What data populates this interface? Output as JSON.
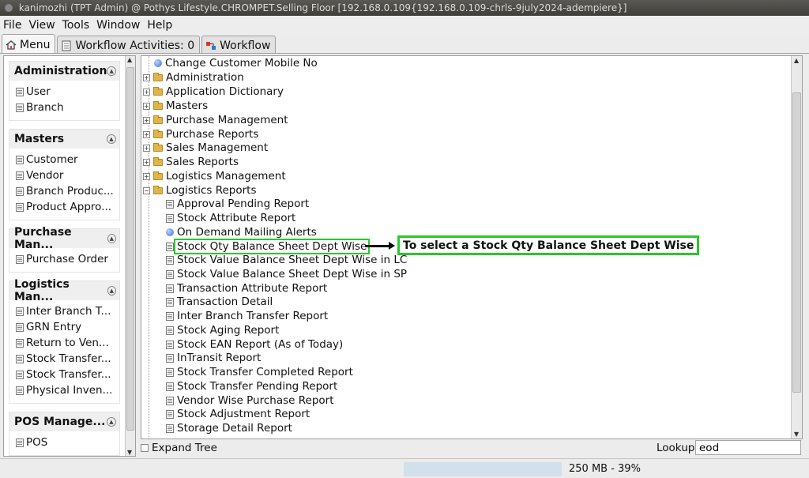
{
  "window": {
    "title": "kanimozhi (TPT Admin) @ Pothys Lifestyle.CHROMPET.Selling Floor [192.168.0.109{192.168.0.109-chrls-9july2024-adempiere}]"
  },
  "menubar": [
    {
      "label": "File"
    },
    {
      "label": "View"
    },
    {
      "label": "Tools"
    },
    {
      "label": "Window"
    },
    {
      "label": "Help"
    }
  ],
  "tabs": [
    {
      "label": "Menu",
      "icon": "home-icon",
      "active": true
    },
    {
      "label": "Workflow Activities: 0",
      "icon": "document-icon",
      "active": false
    },
    {
      "label": "Workflow",
      "icon": "workflow-icon",
      "active": false
    }
  ],
  "sidebar": {
    "groups": [
      {
        "title": "Administration",
        "items": [
          "User",
          "Branch"
        ]
      },
      {
        "title": "Masters",
        "items": [
          "Customer",
          "Vendor",
          "Branch Produc...",
          "Product Appro..."
        ]
      },
      {
        "title": "Purchase Man...",
        "items": [
          "Purchase Order"
        ]
      },
      {
        "title": "Logistics Man...",
        "items": [
          "Inter Branch T...",
          "GRN Entry",
          "Return to Ven...",
          "Stock Transfer...",
          "Stock Transfer...",
          "Physical Inven..."
        ]
      },
      {
        "title": "POS Manage...",
        "items": [
          "POS"
        ]
      }
    ]
  },
  "tree": {
    "top_item": "Change Customer Mobile No",
    "folders": [
      "Administration",
      "Application Dictionary",
      "Masters",
      "Purchase Management",
      "Purchase Reports",
      "Sales Management",
      "Sales Reports",
      "Logistics Management",
      "Logistics Reports"
    ],
    "reports": [
      {
        "label": "Approval Pending Report",
        "icon": "document-icon"
      },
      {
        "label": "Stock Attribute Report",
        "icon": "document-icon"
      },
      {
        "label": "On Demand Mailing Alerts",
        "icon": "globe-icon"
      },
      {
        "label": "Stock Qty Balance Sheet Dept Wise",
        "icon": "document-icon",
        "selected": true
      },
      {
        "label": "Stock Value Balance Sheet Dept Wise in LC",
        "icon": "document-icon"
      },
      {
        "label": "Stock Value Balance Sheet Dept Wise in SP",
        "icon": "document-icon"
      },
      {
        "label": "Transaction Attribute Report",
        "icon": "document-icon"
      },
      {
        "label": "Transaction Detail",
        "icon": "document-icon"
      },
      {
        "label": "Inter Branch Transfer Report",
        "icon": "document-icon"
      },
      {
        "label": "Stock Aging Report",
        "icon": "document-icon"
      },
      {
        "label": "Stock EAN Report (As of Today)",
        "icon": "document-icon"
      },
      {
        "label": "InTransit Report",
        "icon": "document-icon"
      },
      {
        "label": "Stock Transfer Completed Report",
        "icon": "document-icon"
      },
      {
        "label": "Stock Transfer Pending Report",
        "icon": "document-icon"
      },
      {
        "label": "Vendor Wise Purchase Report",
        "icon": "document-icon"
      },
      {
        "label": "Stock Adjustment Report",
        "icon": "document-icon"
      },
      {
        "label": "Storage Detail Report",
        "icon": "document-icon"
      }
    ]
  },
  "annotation": {
    "text": "To select a Stock Qty Balance Sheet Dept Wise",
    "color": "#2ac928"
  },
  "bottom": {
    "expand_label": "Expand Tree",
    "lookup_label": "Lookup",
    "lookup_value": "eod"
  },
  "status": {
    "memory": "250 MB - 39%"
  }
}
